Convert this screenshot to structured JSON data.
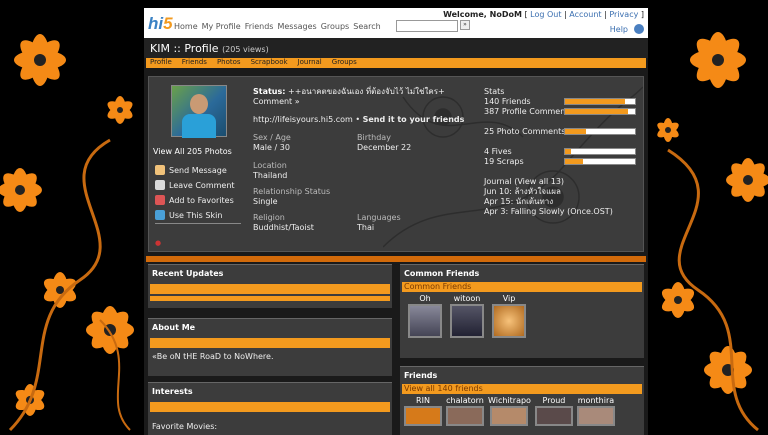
{
  "header": {
    "logo_main": "hi",
    "logo_num": "5",
    "nav": [
      "Home",
      "My Profile",
      "Friends",
      "Messages",
      "Groups",
      "Search"
    ],
    "search_button": "»",
    "welcome": "Welcome, NoDoM",
    "links": [
      "Log Out",
      "Account",
      "Privacy"
    ],
    "help": "Help"
  },
  "profile": {
    "title": "KIM :: Profile",
    "views": "(205 views)",
    "tabs": [
      "Profile",
      "Friends",
      "Photos",
      "Scrapbook",
      "Journal",
      "Groups"
    ],
    "view_all_photos": "View All 205 Photos",
    "actions": [
      "Send Message",
      "Leave Comment",
      "Add to Favorites",
      "Use This Skin"
    ],
    "status_label": "Status:",
    "status_text": "++อนาคตของฉันเอง ที่ต้องจับไว้ ไม่ใช่ใคร+",
    "comment": "Comment »",
    "url": "http://lifeisyours.hi5.com",
    "send_friends": "Send it to your friends",
    "sex_age_label": "Sex / Age",
    "sex_age_value": "Male / 30",
    "birthday_label": "Birthday",
    "birthday_value": "December 22",
    "location_label": "Location",
    "location_value": "Thailand",
    "relationship_label": "Relationship Status",
    "relationship_value": "Single",
    "religion_label": "Religion",
    "religion_value": "Buddhist/Taoist",
    "languages_label": "Languages",
    "languages_value": "Thai"
  },
  "stats": {
    "title": "Stats",
    "rows": [
      {
        "label": "140 Friends",
        "fill": 0.85
      },
      {
        "label": "387 Profile Comments",
        "fill": 0.9
      },
      {
        "label": "25 Photo Comments",
        "fill": 0.3
      },
      {
        "label": "4 Fives",
        "fill": 0.08
      },
      {
        "label": "19 Scraps",
        "fill": 0.25
      }
    ],
    "journal_title": "Journal (View all 13)",
    "journal": [
      "Jun 10: ล้างหัวใจแผล",
      "Apr 15: นักเต้นทาง",
      "Apr 3: Falling Slowly (Once.OST)"
    ]
  },
  "left_panels": {
    "recent_updates": "Recent Updates",
    "about_me": "About Me",
    "about_text": "«Be oN tHE RoaD to NoWhere.",
    "interests": "Interests",
    "favorite_movies": "Favorite Movies:"
  },
  "common_friends": {
    "title": "Common Friends",
    "link": "Common Friends",
    "names": [
      "Oh",
      "witoon",
      "Vip"
    ]
  },
  "friends": {
    "title": "Friends",
    "link": "View all 140 friends",
    "names": [
      "RIN",
      "chalatorn",
      "Wichitrapo",
      "Proud",
      "monthira"
    ]
  },
  "colors": {
    "accent": "#f39a1e",
    "panel": "#3c3c3c",
    "logo_blue": "#3b82c4"
  },
  "icons": [
    "mail-icon",
    "comment-icon",
    "heart-icon",
    "skin-icon",
    "globe-icon"
  ]
}
